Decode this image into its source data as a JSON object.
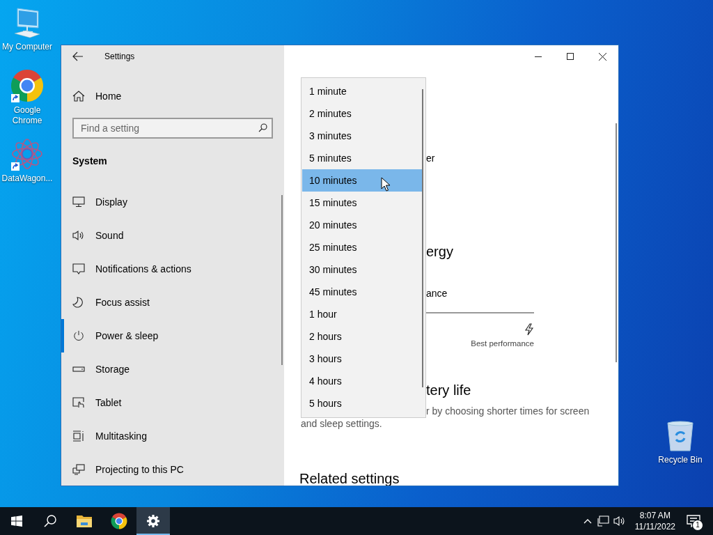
{
  "desktop": {
    "icons": [
      {
        "label": "My Computer",
        "kind": "computer",
        "shortcut": false
      },
      {
        "label": "Google Chrome",
        "kind": "chrome",
        "shortcut": true
      },
      {
        "label": "DataWagon...",
        "kind": "datawagon",
        "shortcut": true
      }
    ],
    "recycle_bin": {
      "label": "Recycle Bin",
      "kind": "recycle"
    }
  },
  "window": {
    "title": "Settings"
  },
  "nav": {
    "home": "Home",
    "search": {
      "placeholder": "Find a setting"
    },
    "section": "System",
    "items": [
      {
        "label": "Display",
        "kind": "display",
        "selected": false
      },
      {
        "label": "Sound",
        "kind": "sound",
        "selected": false
      },
      {
        "label": "Notifications & actions",
        "kind": "notifications",
        "selected": false
      },
      {
        "label": "Focus assist",
        "kind": "focus",
        "selected": false
      },
      {
        "label": "Power & sleep",
        "kind": "power",
        "selected": true
      },
      {
        "label": "Storage",
        "kind": "storage",
        "selected": false
      },
      {
        "label": "Tablet",
        "kind": "tablet",
        "selected": false
      },
      {
        "label": "Multitasking",
        "kind": "multitasking",
        "selected": false
      },
      {
        "label": "Projecting to this PC",
        "kind": "projecting",
        "selected": false
      }
    ]
  },
  "content": [
    {
      "kind": "fragment",
      "text": "er"
    },
    {
      "kind": "fragment_heading",
      "text": "ergy"
    },
    {
      "kind": "fragment",
      "text": "ance"
    },
    {
      "kind": "slider",
      "caption": "Best performance"
    },
    {
      "kind": "fragment_heading",
      "text": "tery life"
    },
    {
      "kind": "note_fragment",
      "text": "r by choosing shorter times for screen"
    },
    {
      "kind": "note",
      "text": "and sleep settings."
    },
    {
      "kind": "heading",
      "text": "Related settings"
    }
  ],
  "dropdown": {
    "options": [
      {
        "label": "1 minute",
        "selected": false
      },
      {
        "label": "2 minutes",
        "selected": false
      },
      {
        "label": "3 minutes",
        "selected": false
      },
      {
        "label": "5 minutes",
        "selected": false
      },
      {
        "label": "10 minutes",
        "selected": true
      },
      {
        "label": "15 minutes",
        "selected": false
      },
      {
        "label": "20 minutes",
        "selected": false
      },
      {
        "label": "25 minutes",
        "selected": false
      },
      {
        "label": "30 minutes",
        "selected": false
      },
      {
        "label": "45 minutes",
        "selected": false
      },
      {
        "label": "1 hour",
        "selected": false
      },
      {
        "label": "2 hours",
        "selected": false
      },
      {
        "label": "3 hours",
        "selected": false
      },
      {
        "label": "4 hours",
        "selected": false
      },
      {
        "label": "5 hours",
        "selected": false
      }
    ]
  },
  "taskbar": {
    "apps": [
      {
        "kind": "start",
        "active": false
      },
      {
        "kind": "search",
        "active": false
      },
      {
        "kind": "explorer",
        "active": false
      },
      {
        "kind": "chrome",
        "active": false
      },
      {
        "kind": "settings",
        "active": true
      }
    ],
    "tray": [
      {
        "kind": "chevron"
      },
      {
        "kind": "network"
      },
      {
        "kind": "volume"
      }
    ],
    "clock": {
      "time": "8:07 AM",
      "date": "11/11/2022"
    },
    "notifications": {
      "count": "1"
    }
  }
}
